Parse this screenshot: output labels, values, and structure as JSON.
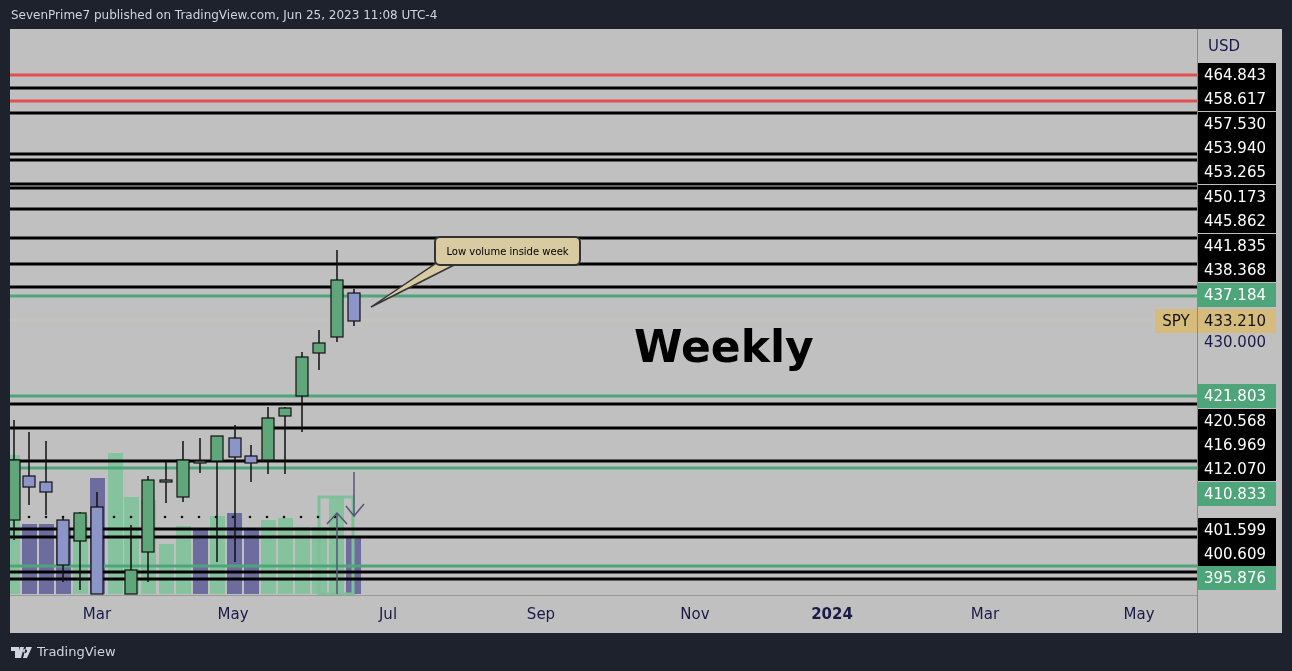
{
  "header": {
    "text": "SevenPrime7 published on TradingView.com, Jun 25, 2023 11:08 UTC-4"
  },
  "chart": {
    "currency": "USD",
    "symbol": "SPY",
    "timeframe_label": "Weekly",
    "callout": "Low volume inside week",
    "price_labels": [
      {
        "text": "464.843",
        "kind": "level"
      },
      {
        "text": "458.617",
        "kind": "level"
      },
      {
        "text": "457.530",
        "kind": "level"
      },
      {
        "text": "453.940",
        "kind": "level"
      },
      {
        "text": "453.265",
        "kind": "level"
      },
      {
        "text": "450.173",
        "kind": "level"
      },
      {
        "text": "445.862",
        "kind": "level"
      },
      {
        "text": "441.835",
        "kind": "level"
      },
      {
        "text": "438.368",
        "kind": "level"
      },
      {
        "text": "437.184",
        "kind": "green"
      },
      {
        "text": "433.210",
        "kind": "price"
      },
      {
        "text": "430.000",
        "kind": "tick"
      },
      {
        "text": "421.803",
        "kind": "green"
      },
      {
        "text": "420.568",
        "kind": "level"
      },
      {
        "text": "416.969",
        "kind": "level"
      },
      {
        "text": "412.070",
        "kind": "level"
      },
      {
        "text": "410.833",
        "kind": "green"
      },
      {
        "text": "401.599",
        "kind": "level"
      },
      {
        "text": "400.609",
        "kind": "level"
      },
      {
        "text": "395.876",
        "kind": "green"
      }
    ],
    "time_labels": [
      {
        "text": "Mar",
        "bold": false
      },
      {
        "text": "May",
        "bold": false
      },
      {
        "text": "Jul",
        "bold": false
      },
      {
        "text": "Sep",
        "bold": false
      },
      {
        "text": "Nov",
        "bold": false
      },
      {
        "text": "2024",
        "bold": true
      },
      {
        "text": "Mar",
        "bold": false
      },
      {
        "text": "May",
        "bold": false
      }
    ]
  },
  "footer": {
    "brand": "TradingView"
  }
}
